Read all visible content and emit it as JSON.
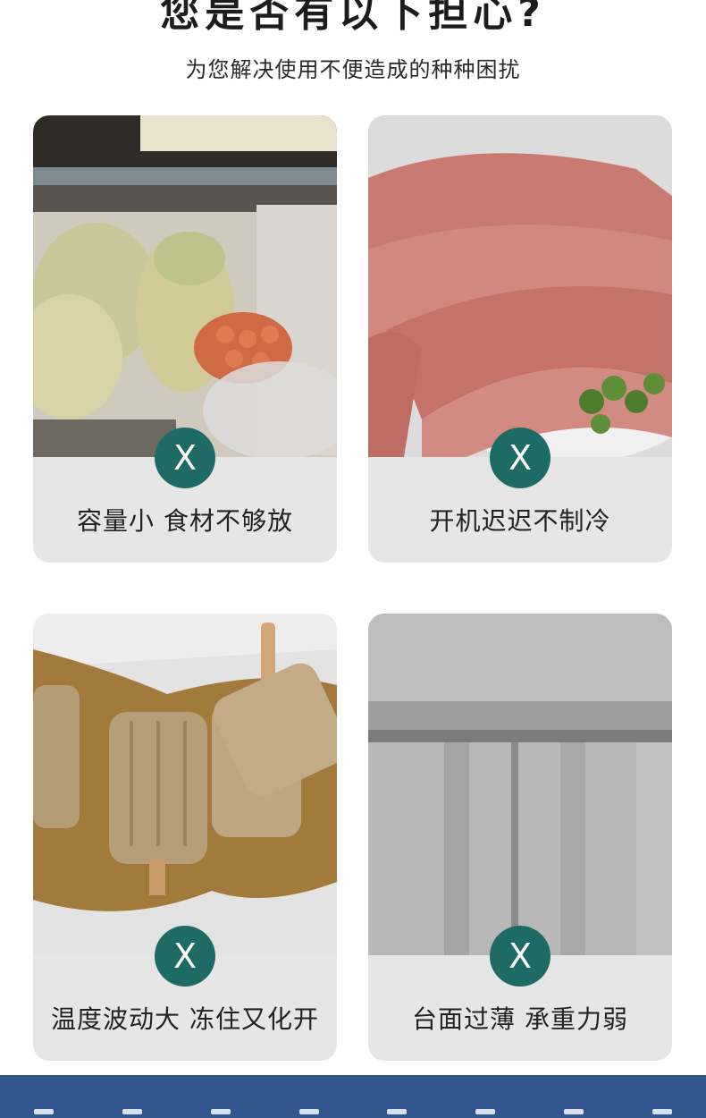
{
  "header": {
    "title": "您是否有以下担心?",
    "subtitle": "为您解决使用不便造成的种种困扰"
  },
  "badge_symbol": "X",
  "cards": [
    {
      "caption": "容量小 食材不够放",
      "image": "cluttered-fridge-shelf"
    },
    {
      "caption": "开机迟迟不制冷",
      "image": "raw-meat-slices"
    },
    {
      "caption": "温度波动大 冻住又化开",
      "image": "melting-popsicles"
    },
    {
      "caption": "台面过薄 承重力弱",
      "image": "steel-counter-panel"
    }
  ],
  "colors": {
    "badge": "#1e6b66",
    "card_bg": "#e6e6e6",
    "footer": "#34568f"
  }
}
